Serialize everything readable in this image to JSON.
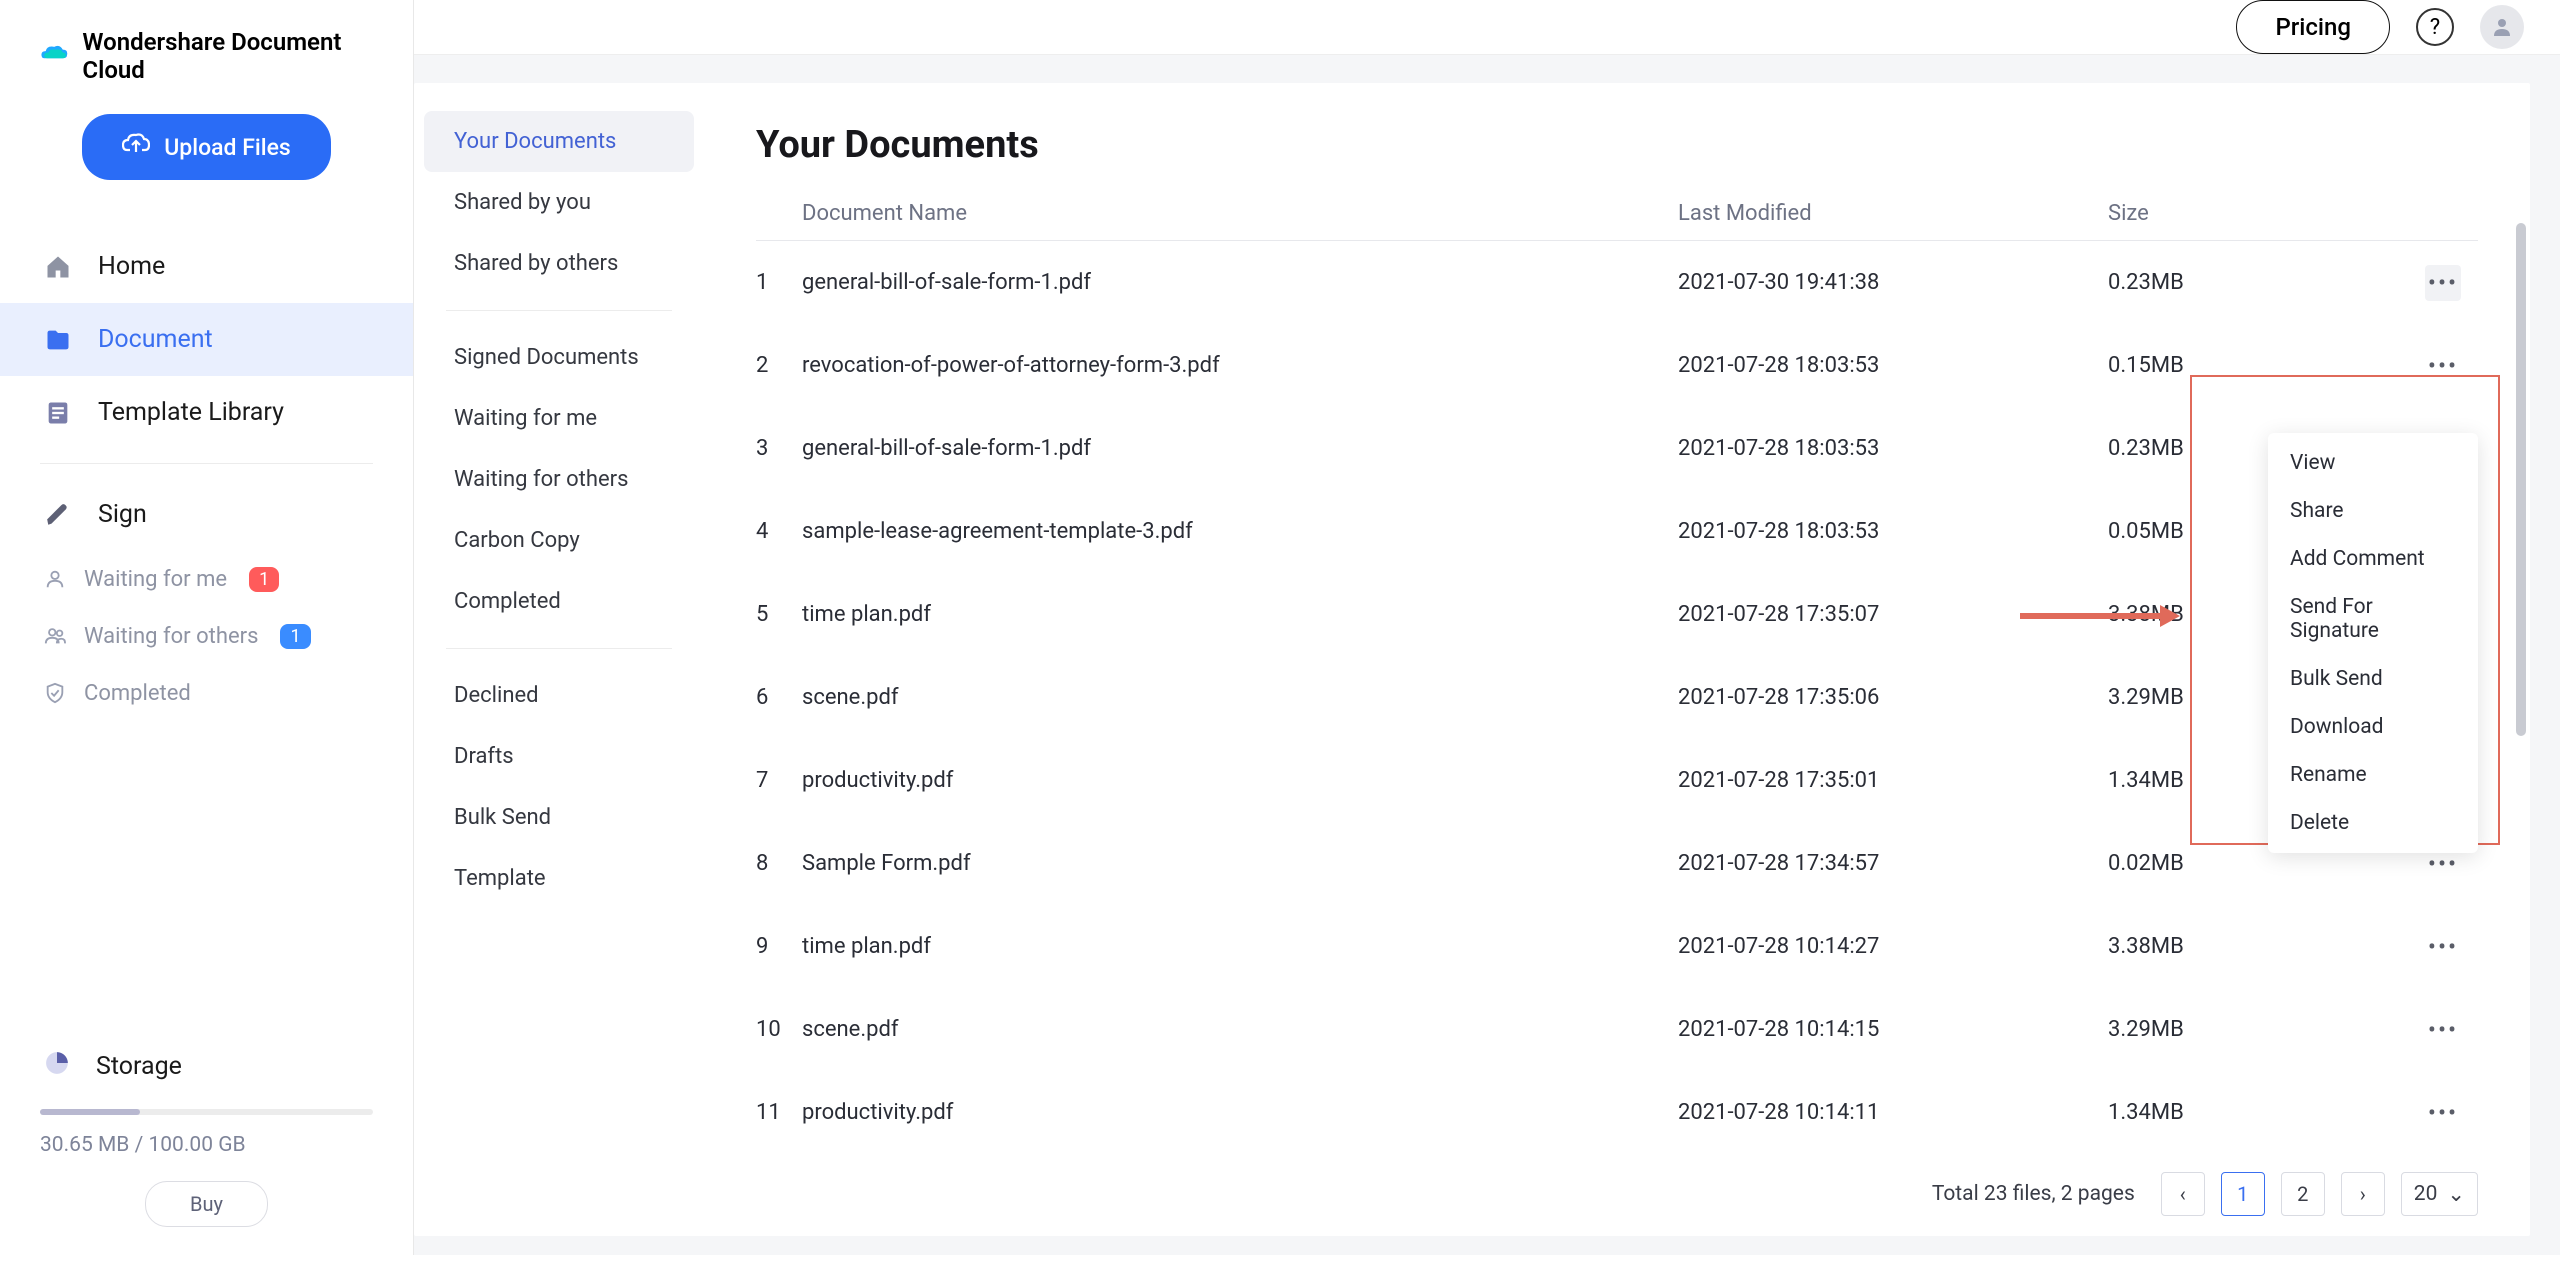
{
  "brand": {
    "name": "Wondershare Document Cloud"
  },
  "sidebar": {
    "upload_label": "Upload Files",
    "nav": [
      {
        "label": "Home",
        "active": false
      },
      {
        "label": "Document",
        "active": true
      },
      {
        "label": "Template Library",
        "active": false
      }
    ],
    "sign_label": "Sign",
    "sub": [
      {
        "label": "Waiting for me",
        "badge": "1",
        "badge_color": "red"
      },
      {
        "label": "Waiting for others",
        "badge": "1",
        "badge_color": "blue"
      },
      {
        "label": "Completed"
      }
    ],
    "storage": {
      "label": "Storage",
      "used": "30.65 MB / 100.00 GB",
      "buy_label": "Buy"
    }
  },
  "topbar": {
    "pricing_label": "Pricing"
  },
  "subnav": {
    "group1": [
      {
        "label": "Your Documents",
        "active": true
      },
      {
        "label": "Shared by you"
      },
      {
        "label": "Shared by others"
      }
    ],
    "group2": [
      {
        "label": "Signed Documents"
      },
      {
        "label": "Waiting for me"
      },
      {
        "label": "Waiting for others"
      },
      {
        "label": "Carbon Copy"
      },
      {
        "label": "Completed"
      }
    ],
    "group3": [
      {
        "label": "Declined"
      },
      {
        "label": "Drafts"
      },
      {
        "label": "Bulk Send"
      },
      {
        "label": "Template"
      }
    ]
  },
  "documents": {
    "title": "Your Documents",
    "headers": {
      "name": "Document Name",
      "modified": "Last Modified",
      "size": "Size"
    },
    "rows": [
      {
        "idx": "1",
        "name": "general-bill-of-sale-form-1.pdf",
        "modified": "2021-07-30 19:41:38",
        "size": "0.23MB"
      },
      {
        "idx": "2",
        "name": "revocation-of-power-of-attorney-form-3.pdf",
        "modified": "2021-07-28 18:03:53",
        "size": "0.15MB"
      },
      {
        "idx": "3",
        "name": "general-bill-of-sale-form-1.pdf",
        "modified": "2021-07-28 18:03:53",
        "size": "0.23MB"
      },
      {
        "idx": "4",
        "name": "sample-lease-agreement-template-3.pdf",
        "modified": "2021-07-28 18:03:53",
        "size": "0.05MB"
      },
      {
        "idx": "5",
        "name": "time plan.pdf",
        "modified": "2021-07-28 17:35:07",
        "size": "3.38MB"
      },
      {
        "idx": "6",
        "name": "scene.pdf",
        "modified": "2021-07-28 17:35:06",
        "size": "3.29MB"
      },
      {
        "idx": "7",
        "name": "productivity.pdf",
        "modified": "2021-07-28 17:35:01",
        "size": "1.34MB"
      },
      {
        "idx": "8",
        "name": "Sample Form.pdf",
        "modified": "2021-07-28 17:34:57",
        "size": "0.02MB"
      },
      {
        "idx": "9",
        "name": "time plan.pdf",
        "modified": "2021-07-28 10:14:27",
        "size": "3.38MB"
      },
      {
        "idx": "10",
        "name": "scene.pdf",
        "modified": "2021-07-28 10:14:15",
        "size": "3.29MB"
      },
      {
        "idx": "11",
        "name": "productivity.pdf",
        "modified": "2021-07-28 10:14:11",
        "size": "1.34MB"
      }
    ],
    "context_menu": [
      "View",
      "Share",
      "Add Comment",
      "Send For Signature",
      "Bulk Send",
      "Download",
      "Rename",
      "Delete"
    ],
    "pager": {
      "info": "Total 23 files, 2 pages",
      "pages": [
        "1",
        "2"
      ],
      "active": "1",
      "page_size": "20"
    }
  }
}
